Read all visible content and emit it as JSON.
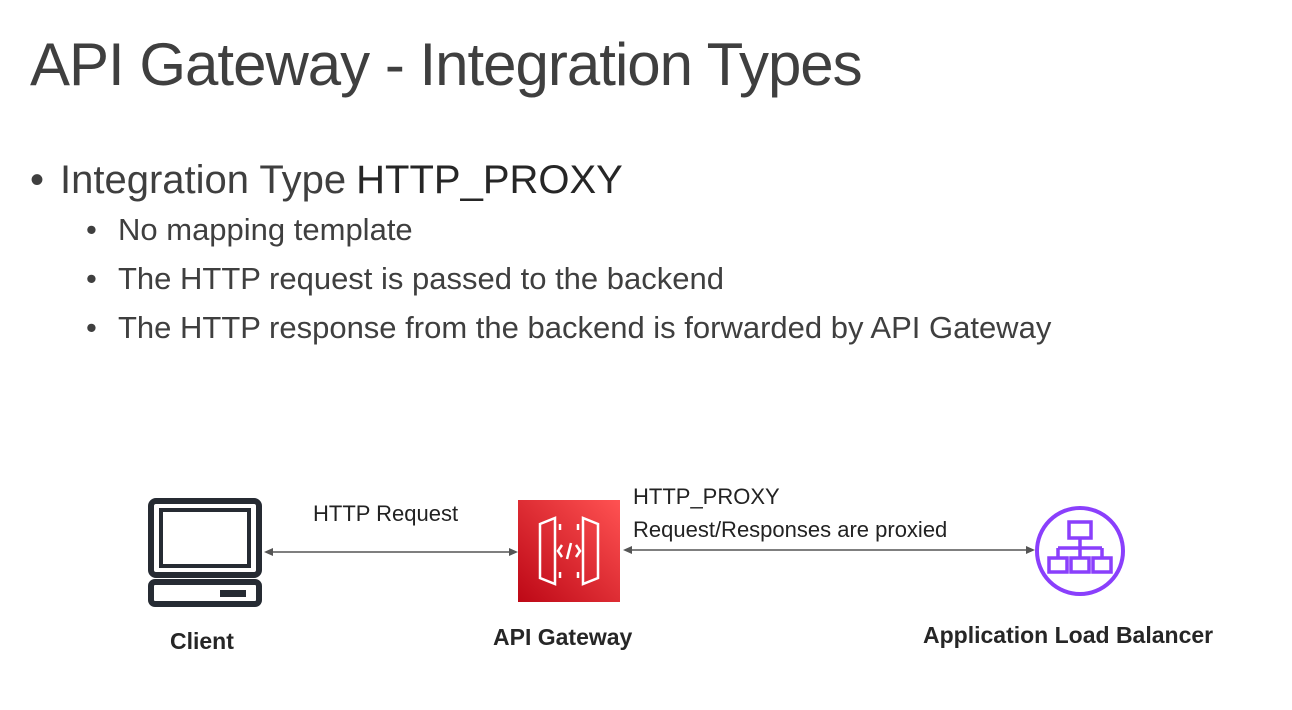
{
  "title": "API Gateway - Integration Types",
  "bullets": {
    "main": {
      "text": "Integration Type",
      "emphasis": "HTTP_PROXY"
    },
    "sub": [
      "No mapping template",
      "The HTTP request is passed to the backend",
      "The HTTP response from the backend is forwarded by API Gateway"
    ]
  },
  "diagram": {
    "nodes": {
      "client": {
        "label": "Client",
        "icon": "laptop-icon"
      },
      "api_gateway": {
        "label": "API Gateway",
        "icon": "api-gateway-icon",
        "color": "#e7232f"
      },
      "alb": {
        "label": "Application Load Balancer",
        "icon": "load-balancer-icon",
        "color": "#8a3ffc"
      }
    },
    "edges": {
      "client_to_gateway": "HTTP Request",
      "gateway_to_alb": {
        "line1": "HTTP_PROXY",
        "line2": "Request/Responses are proxied"
      }
    }
  }
}
